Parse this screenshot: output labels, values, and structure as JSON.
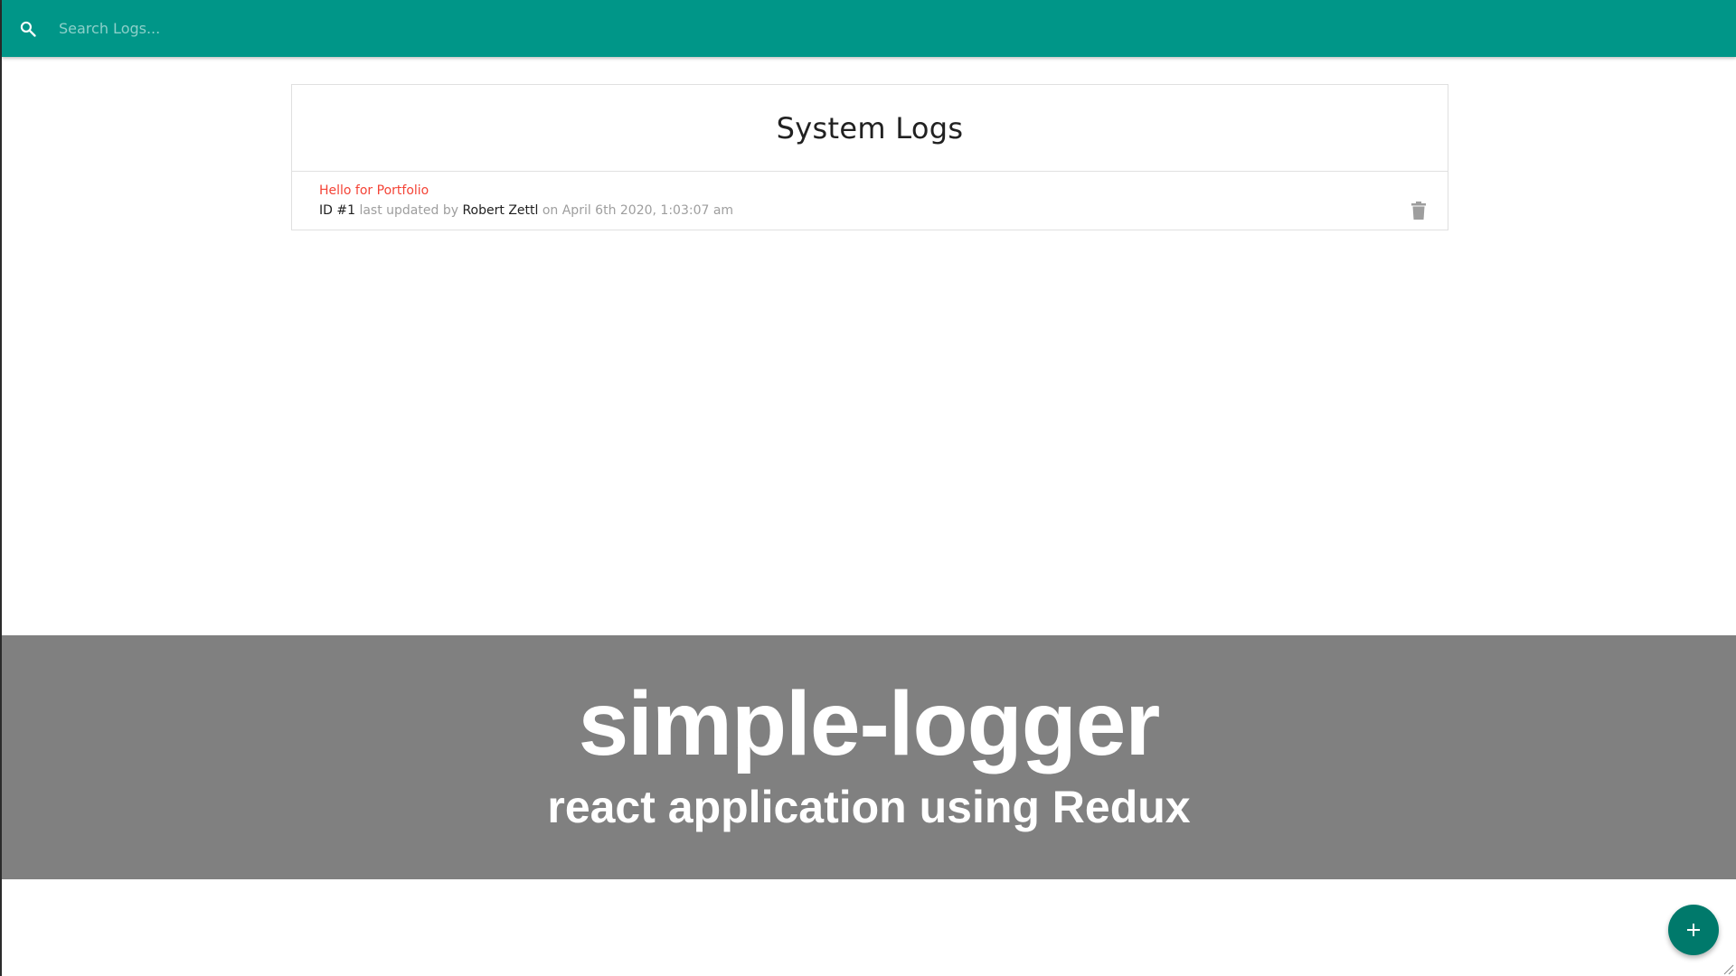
{
  "colors": {
    "navbar": "#009688",
    "fab": "#00796b",
    "log_message": "#f44336",
    "banner": "#808080"
  },
  "navbar": {
    "search_placeholder": "Search Logs...",
    "search_value": "",
    "icon": "search-icon"
  },
  "logs": {
    "title": "System Logs",
    "items": [
      {
        "message": "Hello for Portfolio",
        "id_label": "ID #1",
        "updated_text": "last updated by",
        "tech": "Robert Zettl",
        "date_text": "on April 6th 2020, 1:03:07 am",
        "attention": true,
        "delete_icon": "trash-icon"
      }
    ]
  },
  "banner": {
    "title": "simple-logger",
    "subtitle": "react application using Redux"
  },
  "fab": {
    "label": "+",
    "icon": "add-icon"
  }
}
